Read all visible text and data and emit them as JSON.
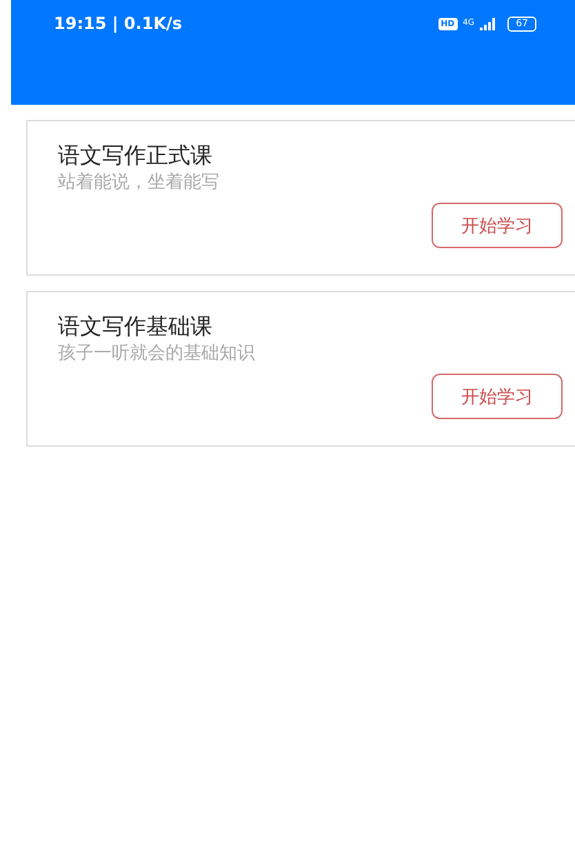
{
  "status_bar": {
    "time_speed": "19:15 | 0.1K/s",
    "hd": "HD",
    "network": "4G",
    "battery": "67"
  },
  "courses": [
    {
      "title": "语文写作正式课",
      "subtitle": "站着能说，坐着能写",
      "button": "开始学习"
    },
    {
      "title": "语文写作基础课",
      "subtitle": "孩子一听就会的基础知识",
      "button": "开始学习"
    }
  ]
}
